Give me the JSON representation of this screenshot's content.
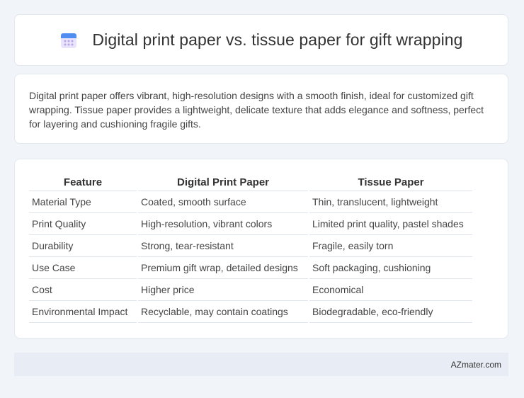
{
  "header": {
    "title": "Digital print paper vs. tissue paper for gift wrapping",
    "icon": "calendar-icon"
  },
  "description": "Digital print paper offers vibrant, high-resolution designs with a smooth finish, ideal for customized gift wrapping. Tissue paper provides a lightweight, delicate texture that adds elegance and softness, perfect for layering and cushioning fragile gifts.",
  "table": {
    "headers": [
      "Feature",
      "Digital Print Paper",
      "Tissue Paper"
    ],
    "rows": [
      [
        "Material Type",
        "Coated, smooth surface",
        "Thin, translucent, lightweight"
      ],
      [
        "Print Quality",
        "High-resolution, vibrant colors",
        "Limited print quality, pastel shades"
      ],
      [
        "Durability",
        "Strong, tear-resistant",
        "Fragile, easily torn"
      ],
      [
        "Use Case",
        "Premium gift wrap, detailed designs",
        "Soft packaging, cushioning"
      ],
      [
        "Cost",
        "Higher price",
        "Economical"
      ],
      [
        "Environmental Impact",
        "Recyclable, may contain coatings",
        "Biodegradable, eco-friendly"
      ]
    ]
  },
  "footer": {
    "brand": "AZmater.com"
  },
  "colors": {
    "background": "#f1f4f9",
    "card": "#ffffff",
    "footer": "#e7ecf5",
    "icon_blue": "#4f8ef0",
    "icon_purple": "#b9a6e8"
  }
}
